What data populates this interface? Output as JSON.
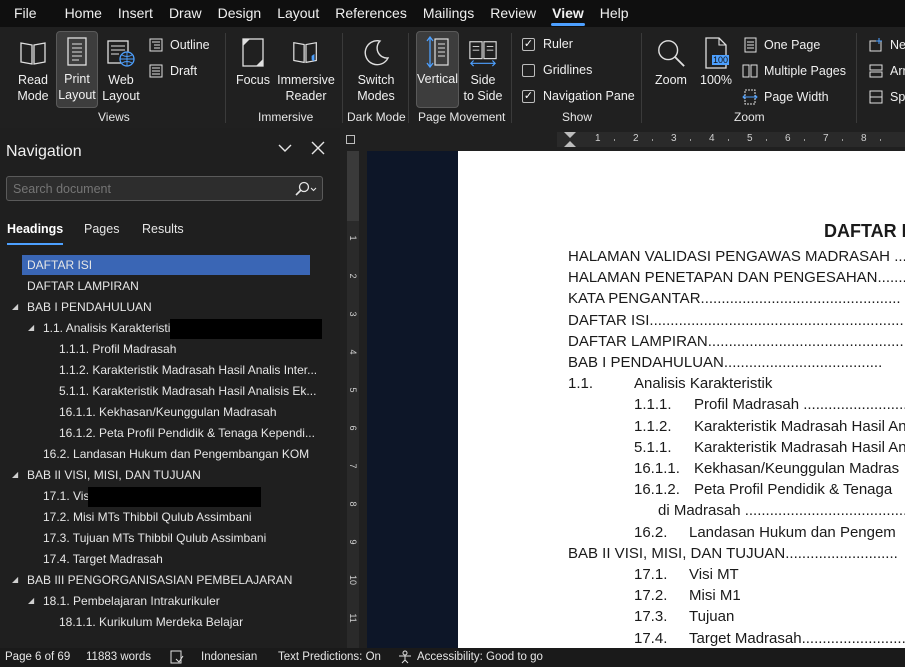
{
  "menu": [
    "File",
    "Home",
    "Insert",
    "Draw",
    "Design",
    "Layout",
    "References",
    "Mailings",
    "Review",
    "View",
    "Help"
  ],
  "active_menu": "View",
  "ribbon": {
    "views": {
      "read_mode": "Read\nMode",
      "print_layout": "Print\nLayout",
      "web_layout": "Web\nLayout",
      "outline": "Outline",
      "draft": "Draft",
      "label": "Views"
    },
    "immersive": {
      "focus": "Focus",
      "immersive_reader": "Immersive\nReader",
      "label": "Immersive"
    },
    "dark_mode": {
      "switch_modes": "Switch\nModes",
      "label": "Dark Mode"
    },
    "page_movement": {
      "vertical": "Vertical",
      "side_to_side": "Side\nto Side",
      "label": "Page Movement"
    },
    "show": {
      "ruler": "Ruler",
      "ruler_checked": true,
      "gridlines": "Gridlines",
      "gridlines_checked": false,
      "navigation_pane": "Navigation Pane",
      "navigation_pane_checked": true,
      "label": "Show"
    },
    "zoom": {
      "zoom": "Zoom",
      "percent": "100%",
      "percent_badge": "100",
      "one_page": "One Page",
      "multiple_pages": "Multiple Pages",
      "page_width": "Page Width",
      "label": "Zoom"
    },
    "window_partial": {
      "new": "Ne",
      "arrange": "Arr",
      "split": "Spl"
    }
  },
  "navigation": {
    "title": "Navigation",
    "search_placeholder": "Search document",
    "tabs": [
      "Headings",
      "Pages",
      "Results"
    ],
    "active_tab": "Headings",
    "headings": [
      {
        "text": "DAFTAR ISI",
        "level": 1,
        "toggle": "",
        "selected": true
      },
      {
        "text": "DAFTAR LAMPIRAN",
        "level": 1,
        "toggle": ""
      },
      {
        "text": "BAB I PENDAHULUAN",
        "level": 1,
        "toggle": "◢"
      },
      {
        "text": "1.1. Analisis Karakteristik",
        "level": 2,
        "toggle": "◢",
        "redacted": true
      },
      {
        "text": "1.1.1. Profil Madrasah",
        "level": 3,
        "toggle": ""
      },
      {
        "text": "1.1.2. Karakteristik Madrasah Hasil Analis Inter...",
        "level": 3,
        "toggle": ""
      },
      {
        "text": "5.1.1. Karakteristik Madrasah Hasil Analisis Ek...",
        "level": 3,
        "toggle": ""
      },
      {
        "text": "16.1.1. Kekhasan/Keunggulan Madrasah",
        "level": 3,
        "toggle": ""
      },
      {
        "text": "16.1.2. Peta Profil Pendidik & Tenaga Kependi...",
        "level": 3,
        "toggle": ""
      },
      {
        "text": "16.2. Landasan Hukum dan Pengembangan KOM",
        "level": 2,
        "toggle": ""
      },
      {
        "text": "BAB II  VISI, MISI, DAN TUJUAN",
        "level": 1,
        "toggle": "◢"
      },
      {
        "text": "17.1. Visi",
        "level": 2,
        "toggle": "",
        "redacted": true
      },
      {
        "text": "17.2. Misi MTs Thibbil Qulub Assimbani",
        "level": 2,
        "toggle": ""
      },
      {
        "text": "17.3. Tujuan MTs Thibbil Qulub Assimbani",
        "level": 2,
        "toggle": ""
      },
      {
        "text": "17.4. Target Madrasah",
        "level": 2,
        "toggle": ""
      },
      {
        "text": "BAB III  PENGORGANISASIAN PEMBELAJARAN",
        "level": 1,
        "toggle": "◢"
      },
      {
        "text": "18.1. Pembelajaran Intrakurikuler",
        "level": 2,
        "toggle": "◢"
      },
      {
        "text": "18.1.1. Kurikulum Merdeka Belajar",
        "level": 3,
        "toggle": ""
      }
    ]
  },
  "ruler": {
    "h_numbers": [
      "1",
      "2",
      "3",
      "4",
      "5",
      "6",
      "7",
      "8"
    ],
    "v_numbers": [
      "1",
      "2",
      "3",
      "4",
      "5",
      "6",
      "7",
      "8",
      "9",
      "10",
      "11"
    ]
  },
  "document": {
    "title": "DAFTAR I",
    "lines": [
      {
        "num": "",
        "text": "HALAMAN VALIDASI PENGAWAS MADRASAH",
        "dots": " ....",
        "indent": 0
      },
      {
        "num": "",
        "text": "HALAMAN PENETAPAN DAN  PENGESAHAN",
        "dots": "..........",
        "indent": 0
      },
      {
        "num": "",
        "text": "KATA PENGANTAR",
        "dots": "................................................",
        "indent": 0
      },
      {
        "num": "",
        "text": "DAFTAR ISI",
        "dots": ".......................................................................",
        "indent": 0
      },
      {
        "num": "",
        "text": "DAFTAR LAMPIRAN",
        "dots": "................................................",
        "indent": 0
      },
      {
        "num": "",
        "text": "BAB I PENDAHULUAN",
        "dots": "......................................",
        "indent": 0
      },
      {
        "num": "1.1.",
        "text": "Analisis Karakteristik",
        "dots": "",
        "indent": 1
      },
      {
        "num": "1.1.1.",
        "text": "Profil Madrasah",
        "dots": " ......................................",
        "indent": 2
      },
      {
        "num": "1.1.2.",
        "text": "Karakteristik Madrasah Hasil An",
        "dots": "",
        "indent": 2
      },
      {
        "num": "5.1.1.",
        "text": "Karakteristik Madrasah Hasil An",
        "dots": "",
        "indent": 2
      },
      {
        "num": "16.1.1.",
        "text": "Kekhasan/Keunggulan Madras",
        "dots": "",
        "indent": 2
      },
      {
        "num": "16.1.2.",
        "text": "Peta Profil Pendidik & Tenaga",
        "dots": "",
        "indent": 2
      },
      {
        "num": "",
        "text": "di Madrasah",
        "dots": " ..................................................",
        "indent": 3
      },
      {
        "num": "16.2.",
        "text": "Landasan Hukum dan Pengem",
        "dots": "",
        "indent": 2
      },
      {
        "num": "",
        "text": "BAB II  VISI, MISI, DAN TUJUAN",
        "dots": "...........................",
        "indent": 0
      },
      {
        "num": "17.1.",
        "text": "Visi MT",
        "dots": "",
        "indent": 2
      },
      {
        "num": "17.2.",
        "text": "Misi M1",
        "dots": "",
        "indent": 2
      },
      {
        "num": "17.3.",
        "text": "Tujuan",
        "dots": "",
        "indent": 2
      },
      {
        "num": "17.4.",
        "text": "Target Madrasah",
        "dots": "...............................",
        "indent": 2
      }
    ]
  },
  "status": {
    "page": "Page 6 of 69",
    "words": "11883 words",
    "language": "Indonesian",
    "text_predictions": "Text Predictions: On",
    "accessibility": "Accessibility: Good to go"
  },
  "colors": {
    "accent": "#4da0ff",
    "selection": "#3a66b5",
    "ribbon_bg": "#202020",
    "doc_bg": "#0d1628"
  }
}
